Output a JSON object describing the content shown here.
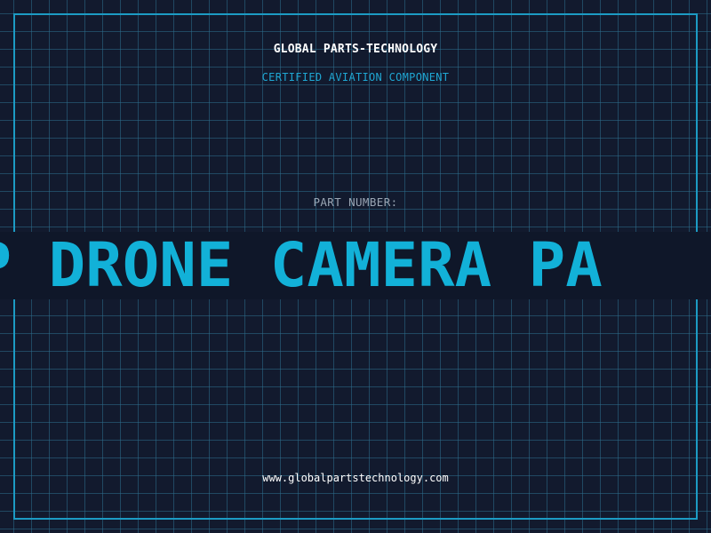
{
  "header": {
    "company": "GLOBAL PARTS-TECHNOLOGY",
    "subtitle": "CERTIFIED AVIATION COMPONENT"
  },
  "part": {
    "label": "PART NUMBER:",
    "ticker_text": "OP DRONE CAMERA PA"
  },
  "footer": {
    "url": "www.globalpartstechnology.com"
  },
  "colors": {
    "background": "#121a2e",
    "grid": "#2d6e8c",
    "frame": "#1c9bc4",
    "accent": "#12b1d8",
    "label": "#9aa6b4",
    "text": "#ffffff"
  }
}
